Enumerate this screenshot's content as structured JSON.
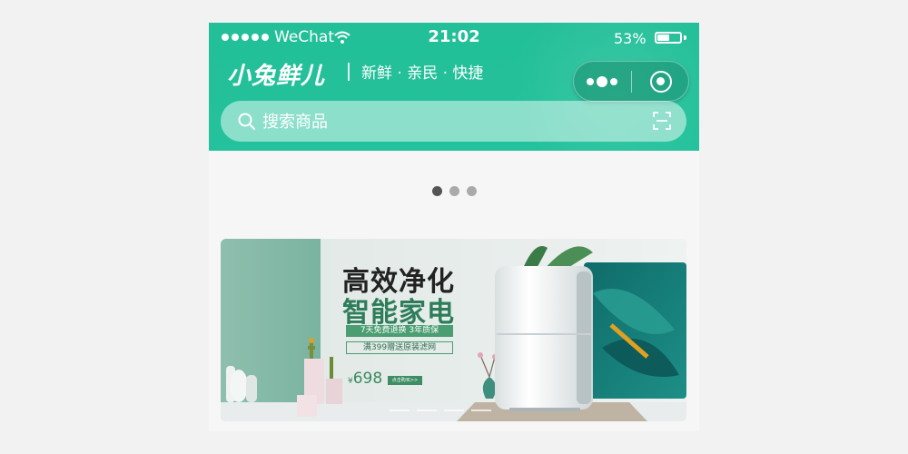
{
  "status_bar": {
    "carrier": "WeChat",
    "time": "21:02",
    "battery_percent": "53%",
    "battery_level": 0.53
  },
  "header": {
    "brand": "小兔鲜儿",
    "slogan": "新鲜 · 亲民 · 快捷",
    "more_icon": "more-dots-icon",
    "close_icon": "circle-close-icon"
  },
  "search": {
    "placeholder": "搜索商品",
    "search_icon": "search-icon",
    "scan_icon": "scan-icon"
  },
  "carousel": {
    "dot_count": 3,
    "active_index": 0
  },
  "banner": {
    "title_line1": "高效净化",
    "title_line2": "智能家电",
    "tag1": "7天免费退换 3年质保",
    "tag2": "满399赠送原装滤网",
    "price_symbol": "¥",
    "price": "698",
    "button": "点击购买>>"
  },
  "colors": {
    "header": "#22bf98",
    "banner_accent": "#3f8d64"
  }
}
